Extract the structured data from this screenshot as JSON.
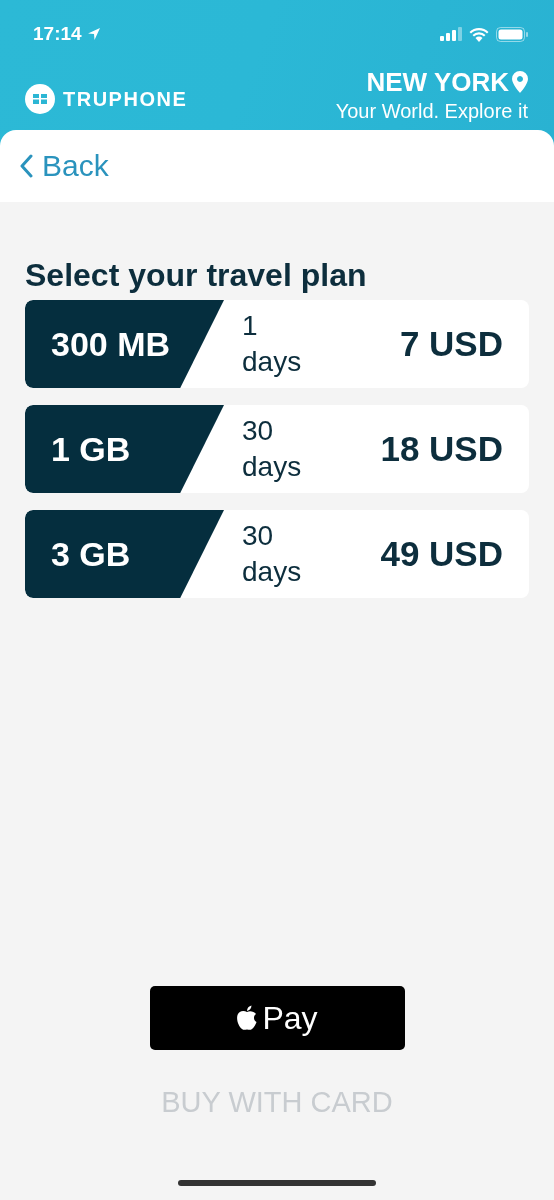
{
  "status_bar": {
    "time": "17:14"
  },
  "header": {
    "brand": "TRUPHONE",
    "city": "NEW YORK",
    "tagline": "Your World. Explore it"
  },
  "nav": {
    "back": "Back"
  },
  "title": "Select your travel plan",
  "plans": [
    {
      "data": "300 MB",
      "duration_number": "1",
      "duration_unit": "days",
      "price": "7 USD"
    },
    {
      "data": "1 GB",
      "duration_number": "30",
      "duration_unit": "days",
      "price": "18 USD"
    },
    {
      "data": "3 GB",
      "duration_number": "30",
      "duration_unit": "days",
      "price": "49 USD"
    }
  ],
  "apple_pay_button": {
    "label": "Pay"
  },
  "card_button": {
    "label": "BUY WITH CARD"
  }
}
